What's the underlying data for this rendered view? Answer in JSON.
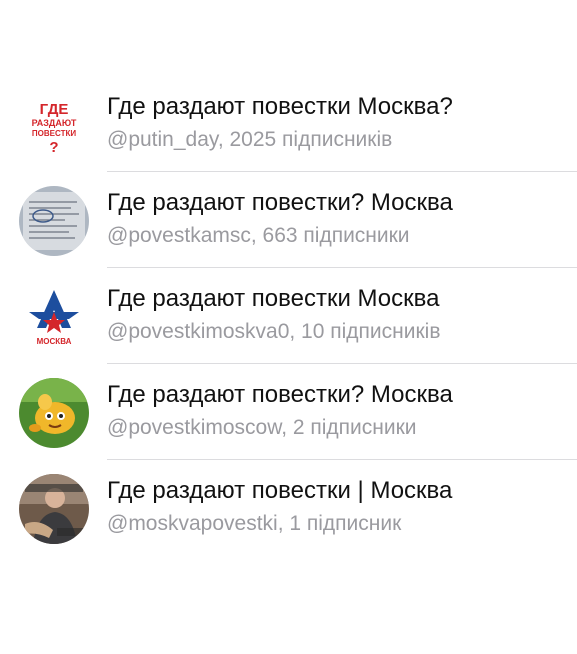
{
  "channels": [
    {
      "title": "Где раздают повестки Москва?",
      "subtitle": "@putin_day, 2025 підписників",
      "avatar_icon": "gde-razdayut-povestki-logo-icon",
      "avatar_text": [
        "ГДЕ",
        "РАЗДАЮТ",
        "ПОВЕСТКИ",
        "?"
      ]
    },
    {
      "title": "Где раздают повестки? Москва",
      "subtitle": "@povestkamsc, 663 підписники",
      "avatar_icon": "summons-document-photo-icon"
    },
    {
      "title": "Где раздают повестки Москва",
      "subtitle": "@povestkimoskva0, 10 підписників",
      "avatar_icon": "star-emblem-logo-icon",
      "avatar_text": [
        "МОСКВА"
      ]
    },
    {
      "title": "Где раздают повестки? Москва",
      "subtitle": "@povestkimoscow, 2 підписники",
      "avatar_icon": "cartoon-character-photo-icon"
    },
    {
      "title": "Где раздают повестки | Москва",
      "subtitle": "@moskvapovestki, 1 підписник",
      "avatar_icon": "person-photo-icon"
    }
  ],
  "colors": {
    "title": "#111111",
    "subtitle": "#9a9a9f",
    "divider": "#dcdcdf",
    "logo_red": "#d4262b",
    "logo_blue": "#1d4e9e"
  }
}
